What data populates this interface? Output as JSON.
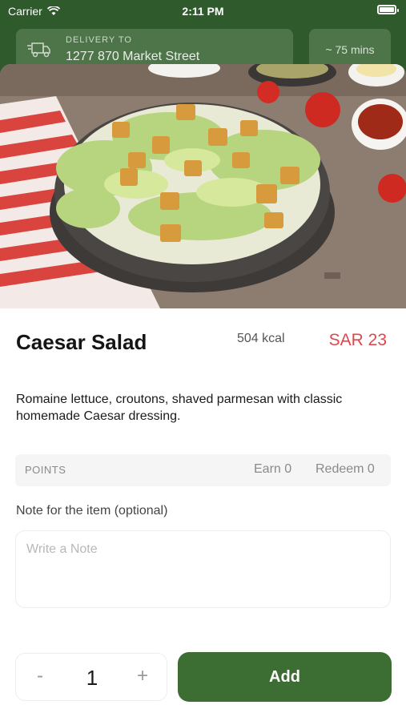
{
  "status_bar": {
    "carrier": "Carrier",
    "time": "2:11 PM"
  },
  "header": {
    "delivery_label": "DELIVERY TO",
    "address": "1277 870 Market Street",
    "eta": "~ 75 mins"
  },
  "item": {
    "name": "Caesar Salad",
    "calories": "504 kcal",
    "price": "SAR 23",
    "description": "Romaine lettuce, croutons, shaved parmesan with classic homemade Caesar dressing."
  },
  "points": {
    "label": "POINTS",
    "earn": "Earn 0",
    "redeem": "Redeem 0"
  },
  "note": {
    "label": "Note for the item (optional)",
    "placeholder": "Write a Note",
    "value": ""
  },
  "quantity": {
    "minus": "-",
    "value": "1",
    "plus": "+"
  },
  "actions": {
    "add_label": "Add"
  },
  "colors": {
    "brand_green": "#3c6e33",
    "price_red": "#e0464b",
    "header_bg": "#2f5a2c"
  },
  "icons": [
    "wifi-icon",
    "battery-icon",
    "delivery-truck-icon",
    "chevron-down-icon"
  ]
}
